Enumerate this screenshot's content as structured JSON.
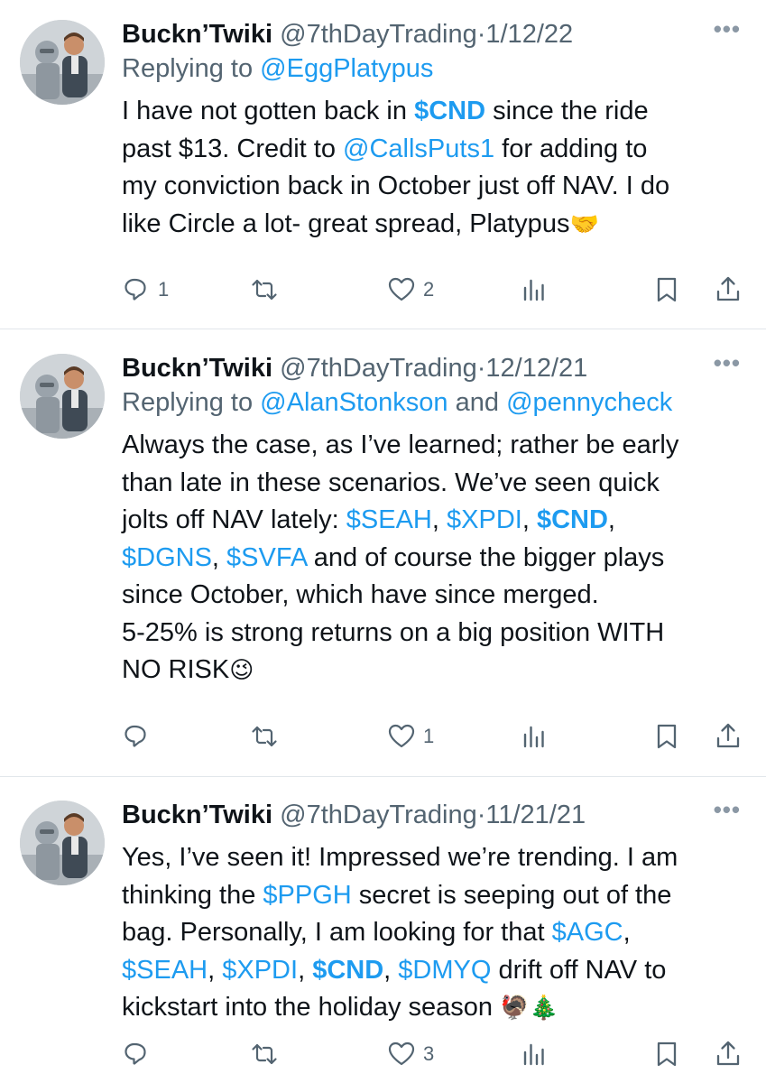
{
  "tweets": [
    {
      "display_name": "Buckn’Twiki",
      "handle": "@7thDayTrading",
      "sep": "·",
      "date": "1/12/22",
      "more": "•••",
      "replying_prefix": "Replying to ",
      "replying_users": [
        "@EggPlatypus"
      ],
      "replying_join": "",
      "body_lines": [
        [
          {
            "t": "I have not gotten back in "
          },
          {
            "t": "$CND",
            "k": "cashb"
          },
          {
            "t": " since the ride"
          }
        ],
        [
          {
            "t": "past $13. Credit to "
          },
          {
            "t": "@CallsPuts1",
            "k": "link"
          },
          {
            "t": " for adding to"
          }
        ],
        [
          {
            "t": "my conviction back in October just off NAV. I do"
          }
        ],
        [
          {
            "t": "like Circle a lot- great spread, Platypus"
          },
          {
            "t": "🤝",
            "k": "emoji"
          }
        ]
      ],
      "reply_count": "1",
      "like_count": "2"
    },
    {
      "display_name": "Buckn’Twiki",
      "handle": "@7thDayTrading",
      "sep": "·",
      "date": "12/12/21",
      "more": "•••",
      "replying_prefix": "Replying to ",
      "replying_users": [
        "@AlanStonkson",
        "@pennycheck"
      ],
      "replying_join": " and ",
      "body_lines": [
        [
          {
            "t": "Always the case, as I’ve learned; rather be early"
          }
        ],
        [
          {
            "t": "than late in these scenarios. We’ve seen quick"
          }
        ],
        [
          {
            "t": "jolts off NAV lately: "
          },
          {
            "t": "$SEAH",
            "k": "cash"
          },
          {
            "t": ", "
          },
          {
            "t": "$XPDI",
            "k": "cash"
          },
          {
            "t": ", "
          },
          {
            "t": "$CND",
            "k": "cashb"
          },
          {
            "t": ","
          }
        ],
        [
          {
            "t": "$DGNS",
            "k": "cash"
          },
          {
            "t": ", "
          },
          {
            "t": "$SVFA",
            "k": "cash"
          },
          {
            "t": " and of course the bigger plays"
          }
        ],
        [
          {
            "t": "since October, which have since merged."
          }
        ],
        [
          {
            "t": "5-25% is strong returns on a big position WITH"
          }
        ],
        [
          {
            "t": "NO RISK"
          },
          {
            "t": "😉",
            "k": "emoji"
          }
        ]
      ],
      "reply_count": "",
      "like_count": "1"
    },
    {
      "display_name": "Buckn’Twiki",
      "handle": "@7thDayTrading",
      "sep": "·",
      "date": "11/21/21",
      "more": "•••",
      "replying_prefix": "",
      "replying_users": [],
      "replying_join": "",
      "body_lines": [
        [
          {
            "t": "Yes, I’ve seen it! Impressed we’re trending. I am"
          }
        ],
        [
          {
            "t": "thinking the "
          },
          {
            "t": "$PPGH",
            "k": "cash"
          },
          {
            "t": " secret is seeping out of the"
          }
        ],
        [
          {
            "t": "bag. Personally, I am looking for that "
          },
          {
            "t": "$AGC",
            "k": "cash"
          },
          {
            "t": ","
          }
        ],
        [
          {
            "t": "$SEAH",
            "k": "cash"
          },
          {
            "t": ", "
          },
          {
            "t": "$XPDI",
            "k": "cash"
          },
          {
            "t": ", "
          },
          {
            "t": "$CND",
            "k": "cashb"
          },
          {
            "t": ", "
          },
          {
            "t": "$DMYQ",
            "k": "cash"
          },
          {
            "t": " drift off NAV to"
          }
        ],
        [
          {
            "t": "kickstart into the holiday season "
          },
          {
            "t": "🦃🎄",
            "k": "emoji"
          }
        ]
      ],
      "reply_count": "",
      "like_count": "3"
    }
  ],
  "icons": {
    "reply": "speech-bubble-icon",
    "retweet": "retweet-arrows-icon",
    "like": "heart-outline-icon",
    "views": "bar-chart-icon",
    "bookmark": "bookmark-icon",
    "share": "share-upload-icon"
  },
  "colors": {
    "link": "#1d9bf0",
    "text": "#0f1419",
    "muted": "#536471",
    "divider": "#e1e6ea"
  }
}
